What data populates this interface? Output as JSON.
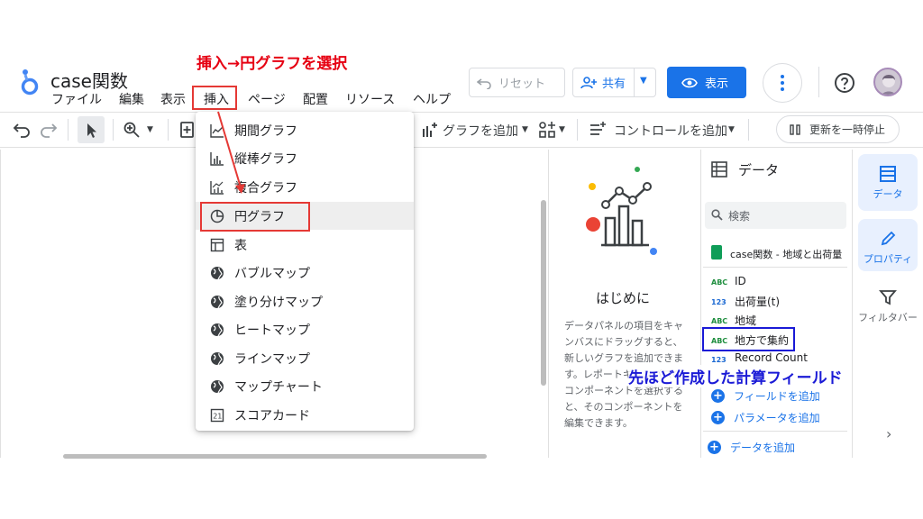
{
  "annotations": {
    "top": "挿入→円グラフを選択",
    "right": "先ほど作成した計算フィールド"
  },
  "header": {
    "title": "case関数",
    "menu": [
      "ファイル",
      "編集",
      "表示",
      "挿入",
      "ページ",
      "配置",
      "リソース",
      "ヘルプ"
    ],
    "reset_label": "リセット",
    "share_label": "共有",
    "view_label": "表示"
  },
  "toolbar": {
    "add_chart_label": "グラフを追加",
    "add_control_label": "コントロールを追加",
    "pause_label": "更新を一時停止"
  },
  "insert_menu": {
    "items": [
      "期間グラフ",
      "縦棒グラフ",
      "複合グラフ",
      "円グラフ",
      "表",
      "バブルマップ",
      "塗り分けマップ",
      "ヒートマップ",
      "ラインマップ",
      "マップチャート",
      "スコアカード"
    ],
    "active_index": 3
  },
  "welcome": {
    "title": "はじめに",
    "body": "データパネルの項目をキャンバスにドラッグすると、新しいグラフを追加できます。レポートキャンバスのコンポーネントを選択すると、そのコンポーネントを編集できます。"
  },
  "data_panel": {
    "title": "データ",
    "search_placeholder": "検索",
    "source_name": "case関数 - 地域と出荷量",
    "fields": [
      {
        "type": "ABC",
        "name": "ID"
      },
      {
        "type": "123",
        "name": "出荷量(t)"
      },
      {
        "type": "ABC",
        "name": "地域"
      },
      {
        "type": "ABC",
        "name": "地方で集約"
      },
      {
        "type": "123",
        "name": "Record Count"
      }
    ],
    "add_field_label": "フィールドを追加",
    "add_parameter_label": "パラメータを追加",
    "add_data_label": "データを追加"
  },
  "rail": {
    "data_label": "データ",
    "properties_label": "プロパティ",
    "filter_label": "フィルタバー"
  },
  "colors": {
    "accent": "#1a73e8",
    "annotation_red": "#e60012",
    "annotation_blue": "#1a1ad6"
  }
}
